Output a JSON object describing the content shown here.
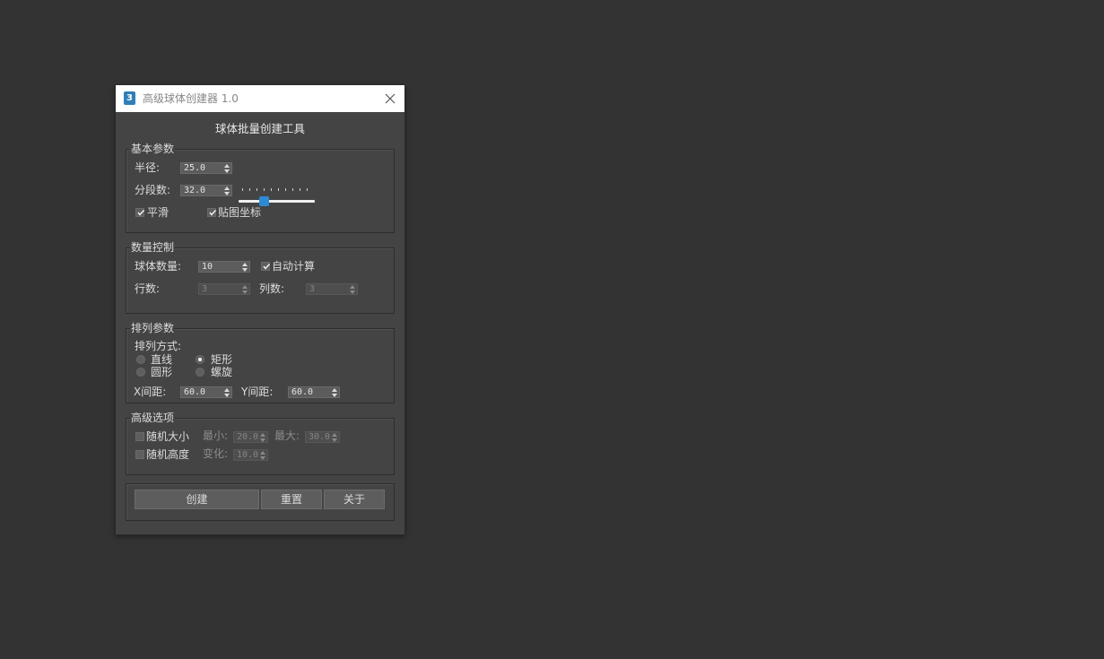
{
  "window": {
    "title": "高级球体创建器 1.0",
    "app_icon_glyph": "3"
  },
  "heading": "球体批量创建工具",
  "basic": {
    "group_label": "基本参数",
    "radius_label": "半径:",
    "radius_value": "25.0",
    "segments_label": "分段数:",
    "segments_value": "32.0",
    "segments_slider_level": 0.33,
    "smooth_label": "平滑",
    "smooth_checked": true,
    "mapcoords_label": "贴图坐标",
    "mapcoords_checked": true
  },
  "count": {
    "group_label": "数量控制",
    "count_label": "球体数量:",
    "count_value": "10",
    "auto_label": "自动计算",
    "auto_checked": true,
    "rows_label": "行数:",
    "rows_value": "3",
    "cols_label": "列数:",
    "cols_value": "3"
  },
  "layout": {
    "group_label": "排列参数",
    "mode_label": "排列方式:",
    "opt_line": "直线",
    "opt_rect": "矩形",
    "opt_circle": "圆形",
    "opt_spiral": "螺旋",
    "selected": "矩形",
    "xspacing_label": "X间距:",
    "xspacing_value": "60.0",
    "yspacing_label": "Y间距:",
    "yspacing_value": "60.0"
  },
  "advanced": {
    "group_label": "高级选项",
    "random_size_label": "随机大小",
    "min_label": "最小:",
    "min_value": "20.0",
    "max_label": "最大:",
    "max_value": "30.0",
    "random_height_label": "随机高度",
    "variation_label": "变化:",
    "variation_value": "10.0"
  },
  "buttons": {
    "create": "创建",
    "reset": "重置",
    "about": "关于"
  },
  "colors": {
    "window_bg": "#444444",
    "desktop_bg": "#333333",
    "slider_accent": "#2f8ad6"
  }
}
